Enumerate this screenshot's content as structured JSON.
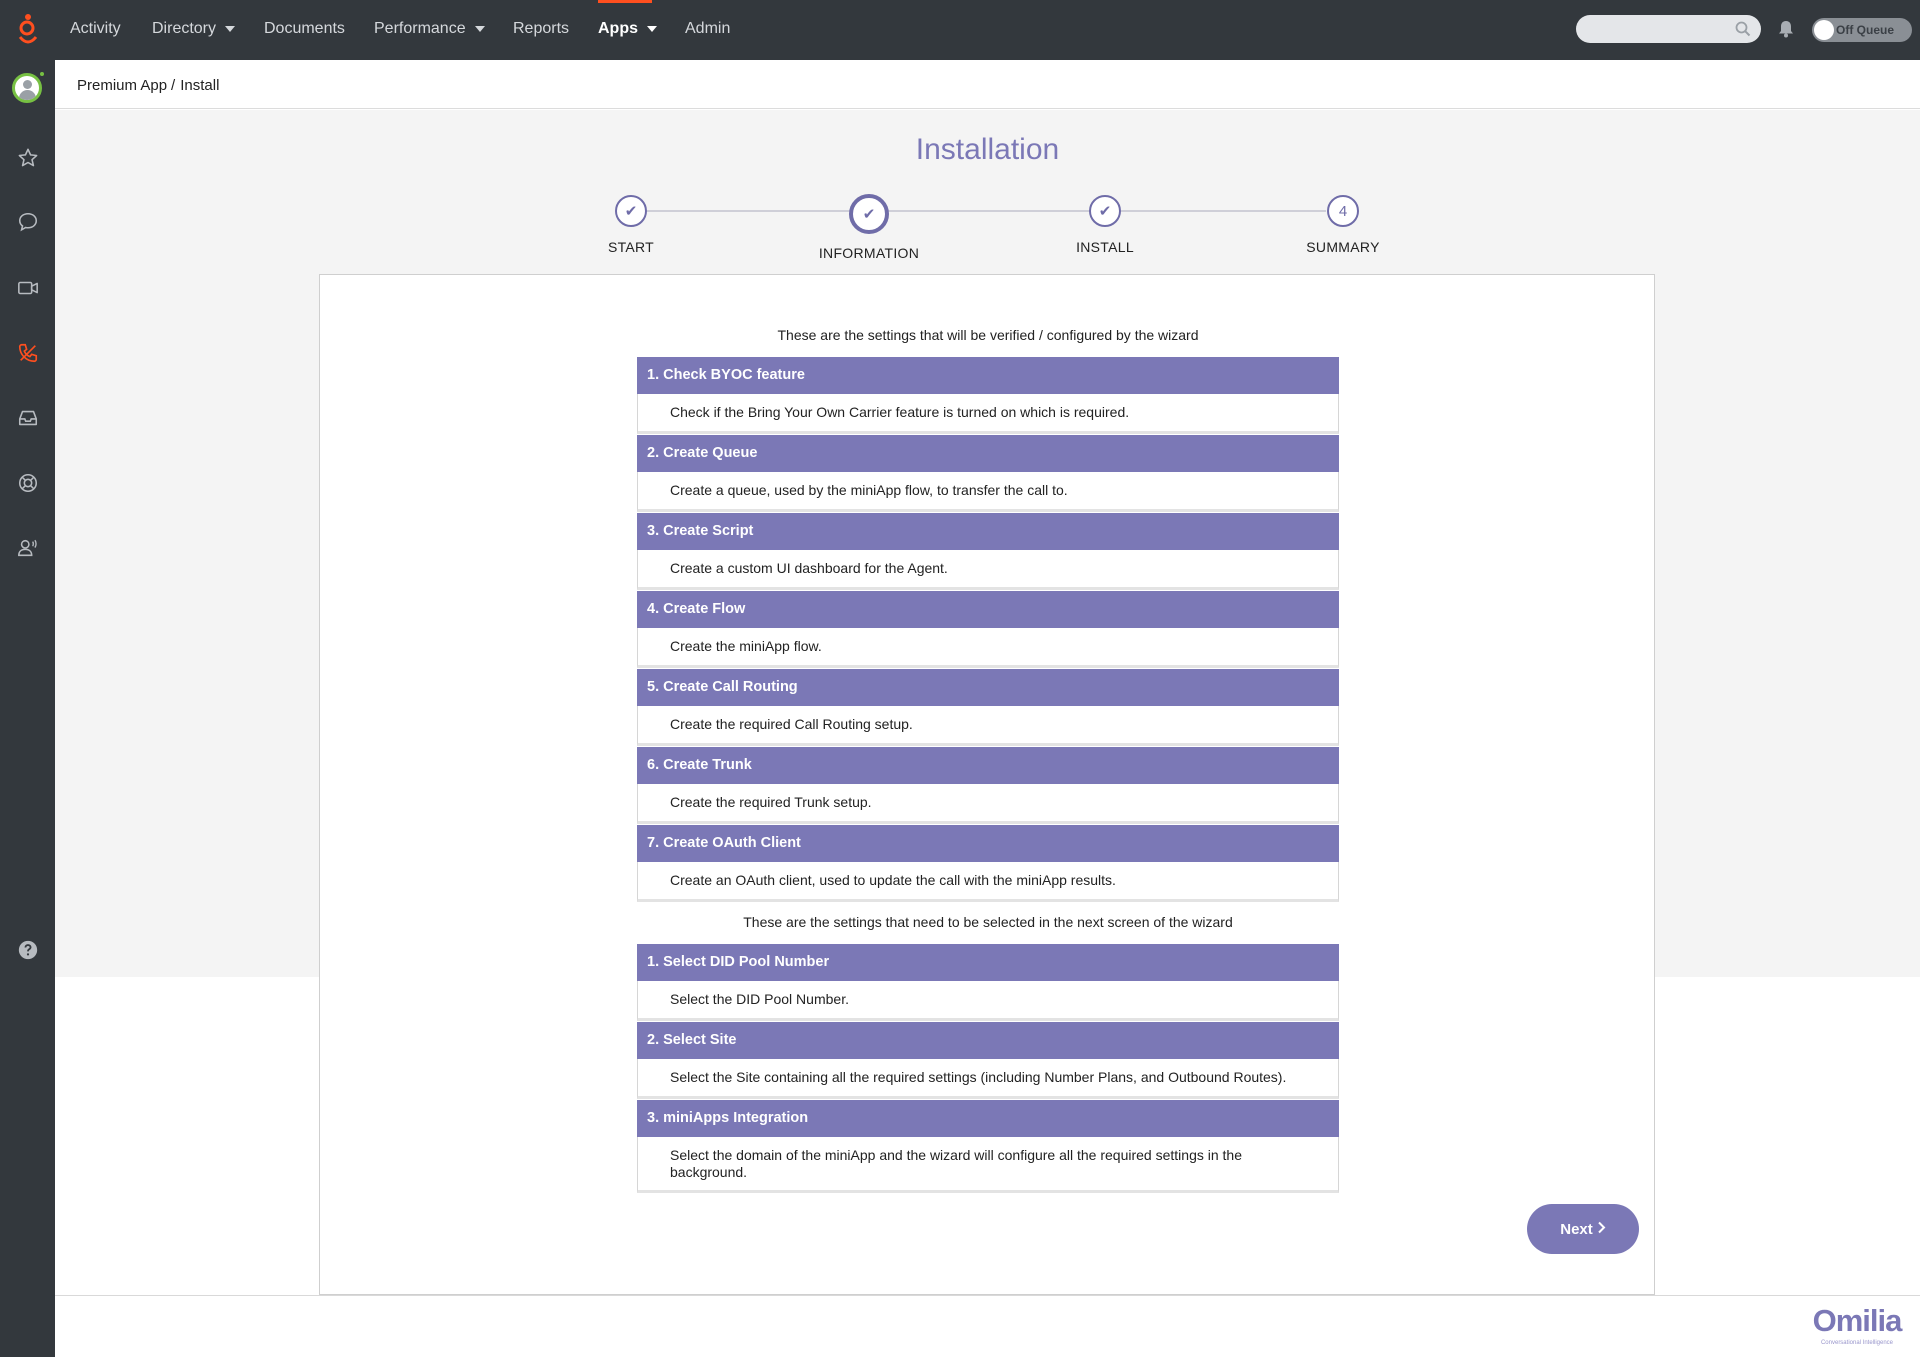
{
  "topnav": {
    "items": [
      {
        "label": "Activity",
        "has_caret": false,
        "active": false
      },
      {
        "label": "Directory",
        "has_caret": true,
        "active": false
      },
      {
        "label": "Documents",
        "has_caret": false,
        "active": false
      },
      {
        "label": "Performance",
        "has_caret": true,
        "active": false
      },
      {
        "label": "Reports",
        "has_caret": false,
        "active": false
      },
      {
        "label": "Apps",
        "has_caret": true,
        "active": true
      },
      {
        "label": "Admin",
        "has_caret": false,
        "active": false
      }
    ],
    "queue_toggle_label": "Off Queue",
    "accent_color": "#ff4f1f"
  },
  "sidebar": {
    "icons": [
      "avatar",
      "star-icon",
      "chat-icon",
      "video-icon",
      "phone-icon",
      "inbox-icon",
      "support-icon",
      "user-voice-icon",
      "help-icon"
    ]
  },
  "breadcrumb": {
    "items": [
      "Premium App",
      "Install"
    ]
  },
  "page": {
    "title": "Installation",
    "title_color": "#7b78b6"
  },
  "steps": [
    {
      "label": "START",
      "state": "done",
      "marker": "✔"
    },
    {
      "label": "INFORMATION",
      "state": "current",
      "marker": "✔"
    },
    {
      "label": "INSTALL",
      "state": "done",
      "marker": "✔"
    },
    {
      "label": "SUMMARY",
      "state": "pending",
      "marker": "4"
    }
  ],
  "verify": {
    "intro": "These are the settings that will be verified / configured by the wizard",
    "items": [
      {
        "title": "1. Check BYOC feature",
        "description": "Check if the Bring Your Own Carrier feature is turned on which is required."
      },
      {
        "title": "2. Create Queue",
        "description": "Create a queue, used by the miniApp flow, to transfer the call to."
      },
      {
        "title": "3. Create Script",
        "description": "Create a custom UI dashboard for the Agent."
      },
      {
        "title": "4. Create Flow",
        "description": "Create the miniApp flow."
      },
      {
        "title": "5. Create Call Routing",
        "description": "Create the required Call Routing setup."
      },
      {
        "title": "6. Create Trunk",
        "description": "Create the required Trunk setup."
      },
      {
        "title": "7. Create OAuth Client",
        "description": "Create an OAuth client, used to update the call with the miniApp results."
      }
    ]
  },
  "select": {
    "intro": "These are the settings that need to be selected in the next screen of the wizard",
    "items": [
      {
        "title": "1. Select DID Pool Number",
        "description": "Select the DID Pool Number."
      },
      {
        "title": "2. Select Site",
        "description": "Select the Site containing all the required settings (including Number Plans, and Outbound Routes)."
      },
      {
        "title": "3. miniApps Integration",
        "description": "Select the domain of the miniApp and the wizard will configure all the required settings in the background."
      }
    ]
  },
  "actions": {
    "next_label": "Next"
  },
  "brand": {
    "name": "Omilia",
    "tagline": "Conversational Intelligence"
  }
}
